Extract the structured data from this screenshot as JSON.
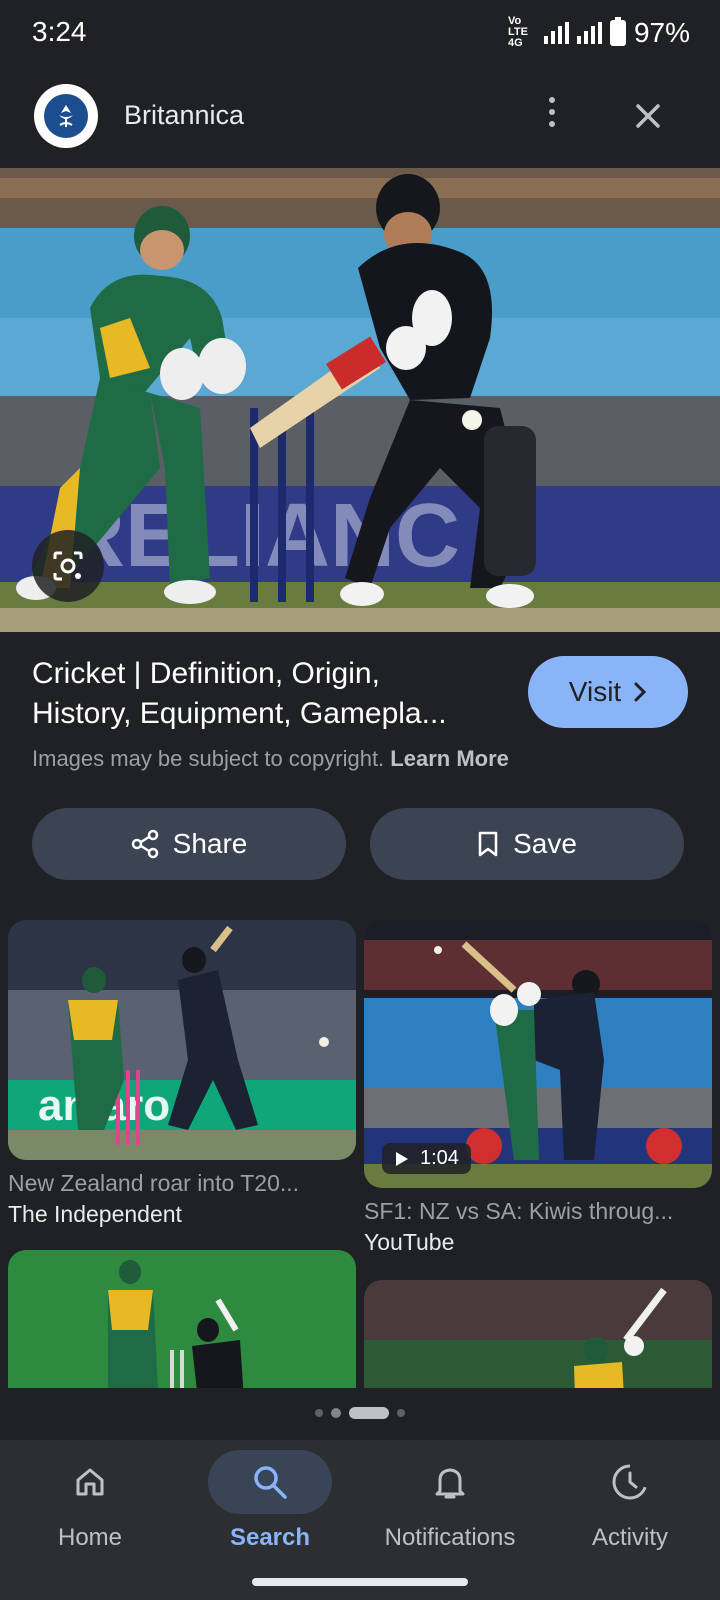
{
  "status_bar": {
    "time": "3:24",
    "network_label": "Vo LTE 4G",
    "battery": "97%"
  },
  "header": {
    "site_name": "Britannica"
  },
  "result": {
    "title_line1": "Cricket | Definition, Origin,",
    "title_line2": "History, Equipment, Gamepla...",
    "visit_label": "Visit",
    "copyright_text": "Images may be subject to copyright.",
    "learn_more": "Learn More"
  },
  "actions": {
    "share_label": "Share",
    "save_label": "Save"
  },
  "related": [
    {
      "title": "New Zealand roar into T20...",
      "source": "The Independent"
    },
    {
      "title": "SF1: NZ vs SA: Kiwis throug...",
      "source": "YouTube",
      "duration": "1:04"
    },
    {
      "title": "",
      "source": ""
    },
    {
      "title": "",
      "source": ""
    }
  ],
  "nav": {
    "items": [
      {
        "label": "Home",
        "icon": "home-icon"
      },
      {
        "label": "Search",
        "icon": "search-icon",
        "active": true
      },
      {
        "label": "Notifications",
        "icon": "bell-icon"
      },
      {
        "label": "Activity",
        "icon": "activity-icon"
      }
    ]
  },
  "colors": {
    "accent": "#8ab4f8",
    "background": "#202124",
    "pill": "#3c4453"
  }
}
